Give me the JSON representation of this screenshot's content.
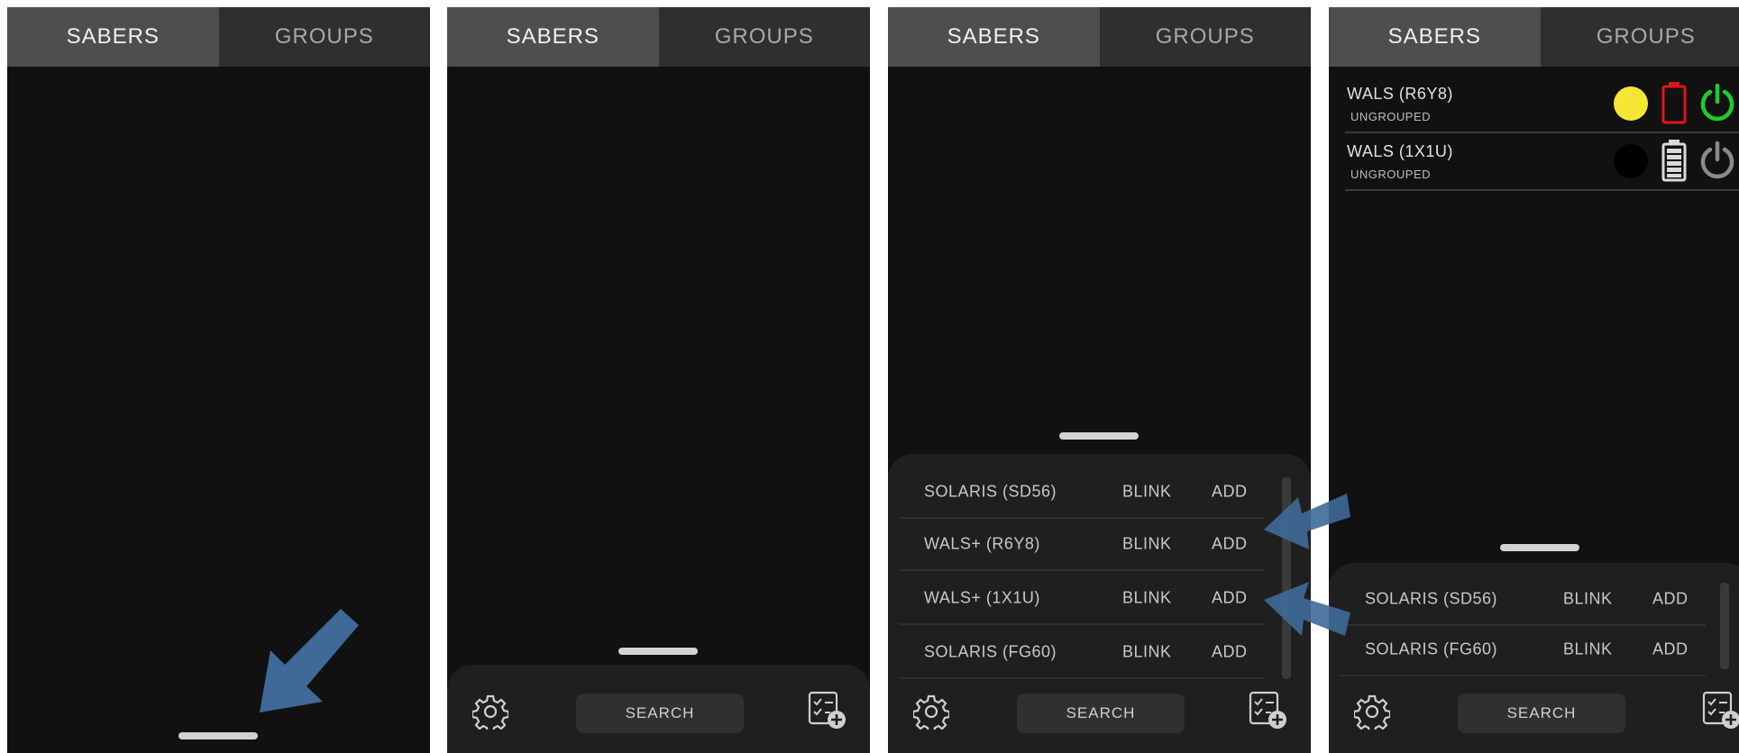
{
  "tabs": {
    "sabers": "SABERS",
    "groups": "GROUPS"
  },
  "footer": {
    "search_label": "SEARCH"
  },
  "scan_results_panel3": [
    {
      "name": "SOLARIS (SD56)",
      "blink": "BLINK",
      "add": "ADD"
    },
    {
      "name": "WALS+ (R6Y8)",
      "blink": "BLINK",
      "add": "ADD"
    },
    {
      "name": "WALS+ (1X1U)",
      "blink": "BLINK",
      "add": "ADD"
    },
    {
      "name": "SOLARIS (FG60)",
      "blink": "BLINK",
      "add": "ADD"
    }
  ],
  "scan_results_panel4": [
    {
      "name": "SOLARIS (SD56)",
      "blink": "BLINK",
      "add": "ADD"
    },
    {
      "name": "SOLARIS (FG60)",
      "blink": "BLINK",
      "add": "ADD"
    }
  ],
  "sabers": [
    {
      "name": "WALS (R6Y8)",
      "group": "UNGROUPED",
      "color": "#f5e635",
      "battery": "low",
      "power": "on"
    },
    {
      "name": "WALS (1X1U)",
      "group": "UNGROUPED",
      "color": "#000000",
      "battery": "full",
      "power": "off"
    }
  ],
  "colors": {
    "arrow": "#3f6a97",
    "battery_low": "#e0141e",
    "power_on": "#1fcc2a",
    "power_off": "#8a8a8a"
  },
  "icons": [
    "gear-icon",
    "add-list-icon",
    "battery-low-icon",
    "battery-full-icon",
    "power-on-icon",
    "power-off-icon",
    "arrow-pointer-icon"
  ]
}
